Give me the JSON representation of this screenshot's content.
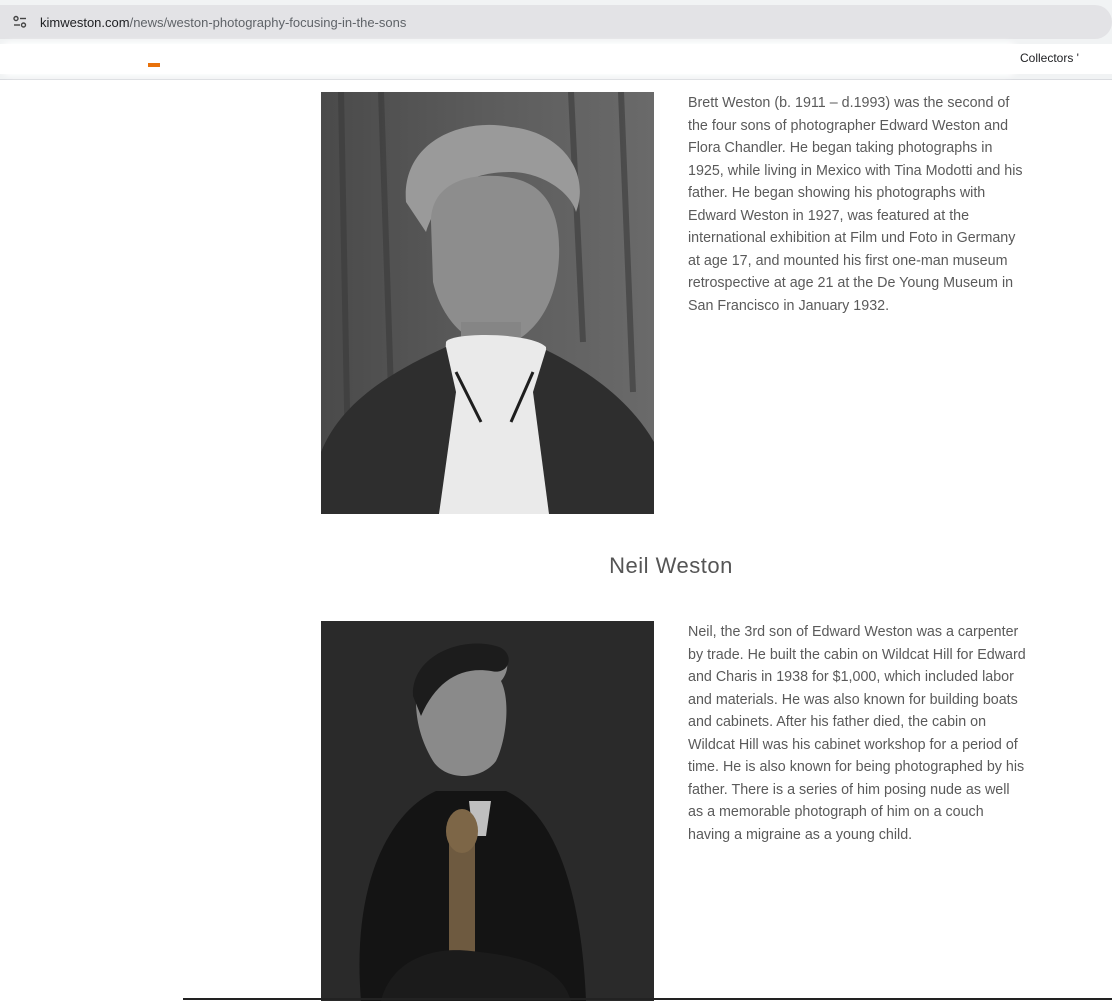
{
  "browser": {
    "url_host": "kimweston.com",
    "url_path": "/news/weston-photography-focusing-in-the-sons",
    "bookmark_label": "Collectors '"
  },
  "sections": [
    {
      "heading": "",
      "image_alt": "Portrait of Brett Weston",
      "bio": "Brett Weston (b. 1911 – d.1993) was the second of the four sons of photographer Edward Weston and Flora Chandler. He began taking photographs in 1925, while living in Mexico with Tina Modotti and his father. He began showing his photographs with Edward Weston in 1927, was featured at the international exhibition at Film und Foto in Germany at age 17, and mounted his first one-man museum retrospective at age 21 at the De Young Museum in San Francisco in January 1932."
    },
    {
      "heading": "Neil Weston",
      "image_alt": "Portrait of Neil Weston",
      "bio": "Neil, the 3rd son of Edward Weston was a carpenter by trade. He built the cabin on Wildcat Hill for Edward and Charis in 1938 for $1,000, which included labor and materials. He was also known for building boats and cabinets. After his father died, the cabin on Wildcat Hill was his cabinet workshop for a period of time. He is also known for being photographed by his father. There is a series of him posing nude as well as a memorable photograph of him on a couch having a migraine as a young child."
    }
  ],
  "colors": {
    "text": "#5a5a5a",
    "chrome": "#e3e3e6"
  }
}
